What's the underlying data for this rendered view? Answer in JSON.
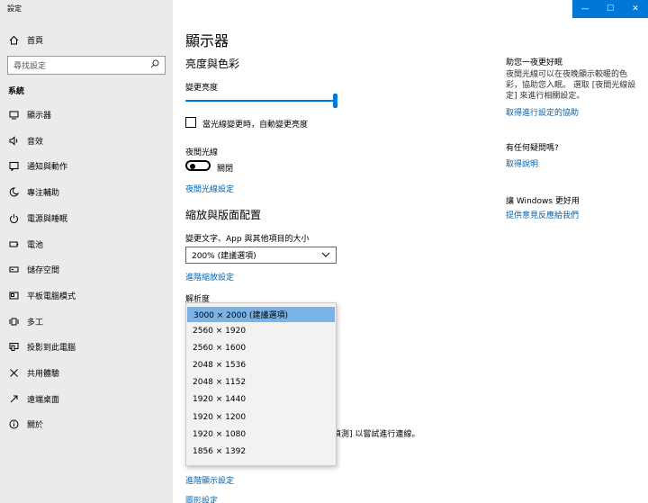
{
  "window": {
    "title": "設定",
    "controls": [
      "—",
      "☐",
      "✕"
    ]
  },
  "sidebar": {
    "home_label": "首頁",
    "search_placeholder": "尋找設定",
    "section_title": "系統",
    "items": [
      {
        "label": "顯示器",
        "icon": "monitor-icon"
      },
      {
        "label": "音效",
        "icon": "speaker-icon"
      },
      {
        "label": "通知與動作",
        "icon": "notification-icon"
      },
      {
        "label": "專注輔助",
        "icon": "moon-icon"
      },
      {
        "label": "電源與睡眠",
        "icon": "power-icon"
      },
      {
        "label": "電池",
        "icon": "battery-icon"
      },
      {
        "label": "儲存空間",
        "icon": "storage-icon"
      },
      {
        "label": "平板電腦模式",
        "icon": "tablet-icon"
      },
      {
        "label": "多工",
        "icon": "multitask-icon"
      },
      {
        "label": "投影到此電腦",
        "icon": "project-icon"
      },
      {
        "label": "共用體驗",
        "icon": "shared-icon"
      },
      {
        "label": "遠端桌面",
        "icon": "remote-icon"
      },
      {
        "label": "關於",
        "icon": "info-icon"
      }
    ]
  },
  "main": {
    "page_title": "顯示器",
    "color_heading": "亮度與色彩",
    "brightness_label": "變更亮度",
    "brightness_value": 1.0,
    "auto_brightness_label": "當光線變更時，自動變更亮度",
    "night_light_label": "夜間光線",
    "night_light_state": "關閉",
    "night_light_link": "夜間光線設定",
    "scale_heading": "縮放與版面配置",
    "scale_label": "變更文字、App 與其他項目的大小",
    "scale_value": "200% (建議選項)",
    "advanced_scale_link": "進階縮放設定",
    "resolution_label": "解析度",
    "resolution_options": [
      "3000 × 2000 (建議選項)",
      "2560 × 1920",
      "2560 × 1600",
      "2048 × 1536",
      "2048 × 1152",
      "1920 × 1440",
      "1920 × 1200",
      "1920 × 1080",
      "1856 × 1392"
    ],
    "detect_text_fragment": "偵測] 以嘗試進行連線。",
    "advanced_display_link": "進階顯示設定",
    "graphics_link": "圖形設定"
  },
  "right": {
    "help_title": "助您一夜更好眠",
    "help_text": "夜間光線可以在夜晚顯示較暖的色彩，協助您入眠。 選取 [夜間光線設定] 來進行相關設定。",
    "help_link": "取得進行設定的協助",
    "question_title": "有任何疑問嗎?",
    "question_link": "取得說明",
    "feedback_title": "讓 Windows 更好用",
    "feedback_link": "提供意見反應給我們"
  }
}
